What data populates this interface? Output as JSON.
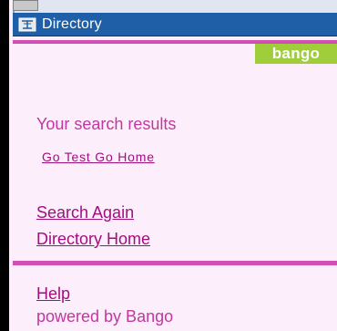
{
  "window": {
    "title": "Directory",
    "icon": "directory-icon"
  },
  "logo": {
    "text": "bango",
    "color": "#9fce3a"
  },
  "results": {
    "heading": "Your search results",
    "items": [
      {
        "label": "Go Test Go Home"
      }
    ]
  },
  "nav": {
    "search_again": "Search Again",
    "directory_home": "Directory Home",
    "help": "Help"
  },
  "footer": {
    "text": "powered by Bango"
  },
  "colors": {
    "accent": "#d14fb4",
    "link": "#a00f7e",
    "text": "#c0399e",
    "background": "#fdeefb",
    "titlebar": "#1e5fa8"
  }
}
